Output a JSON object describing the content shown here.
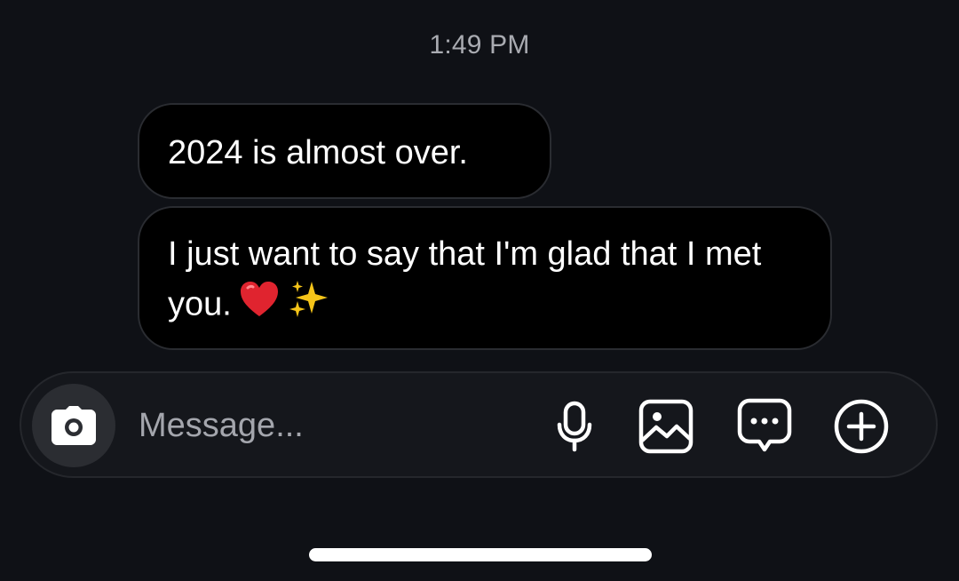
{
  "conversation": {
    "timestamp": "1:49 PM",
    "messages": [
      {
        "text": "2024 is almost over."
      },
      {
        "text": "I just want to say that I'm glad that I met you."
      }
    ]
  },
  "composer": {
    "placeholder": "Message...",
    "icons": [
      "camera-icon",
      "microphone-icon",
      "gallery-icon",
      "sticker-icon",
      "plus-circle-icon"
    ]
  },
  "colors": {
    "background": "#0f1116",
    "bubble": "#000000",
    "composer": "#15171c",
    "text": "#ffffff",
    "muted": "#a9abb1"
  }
}
